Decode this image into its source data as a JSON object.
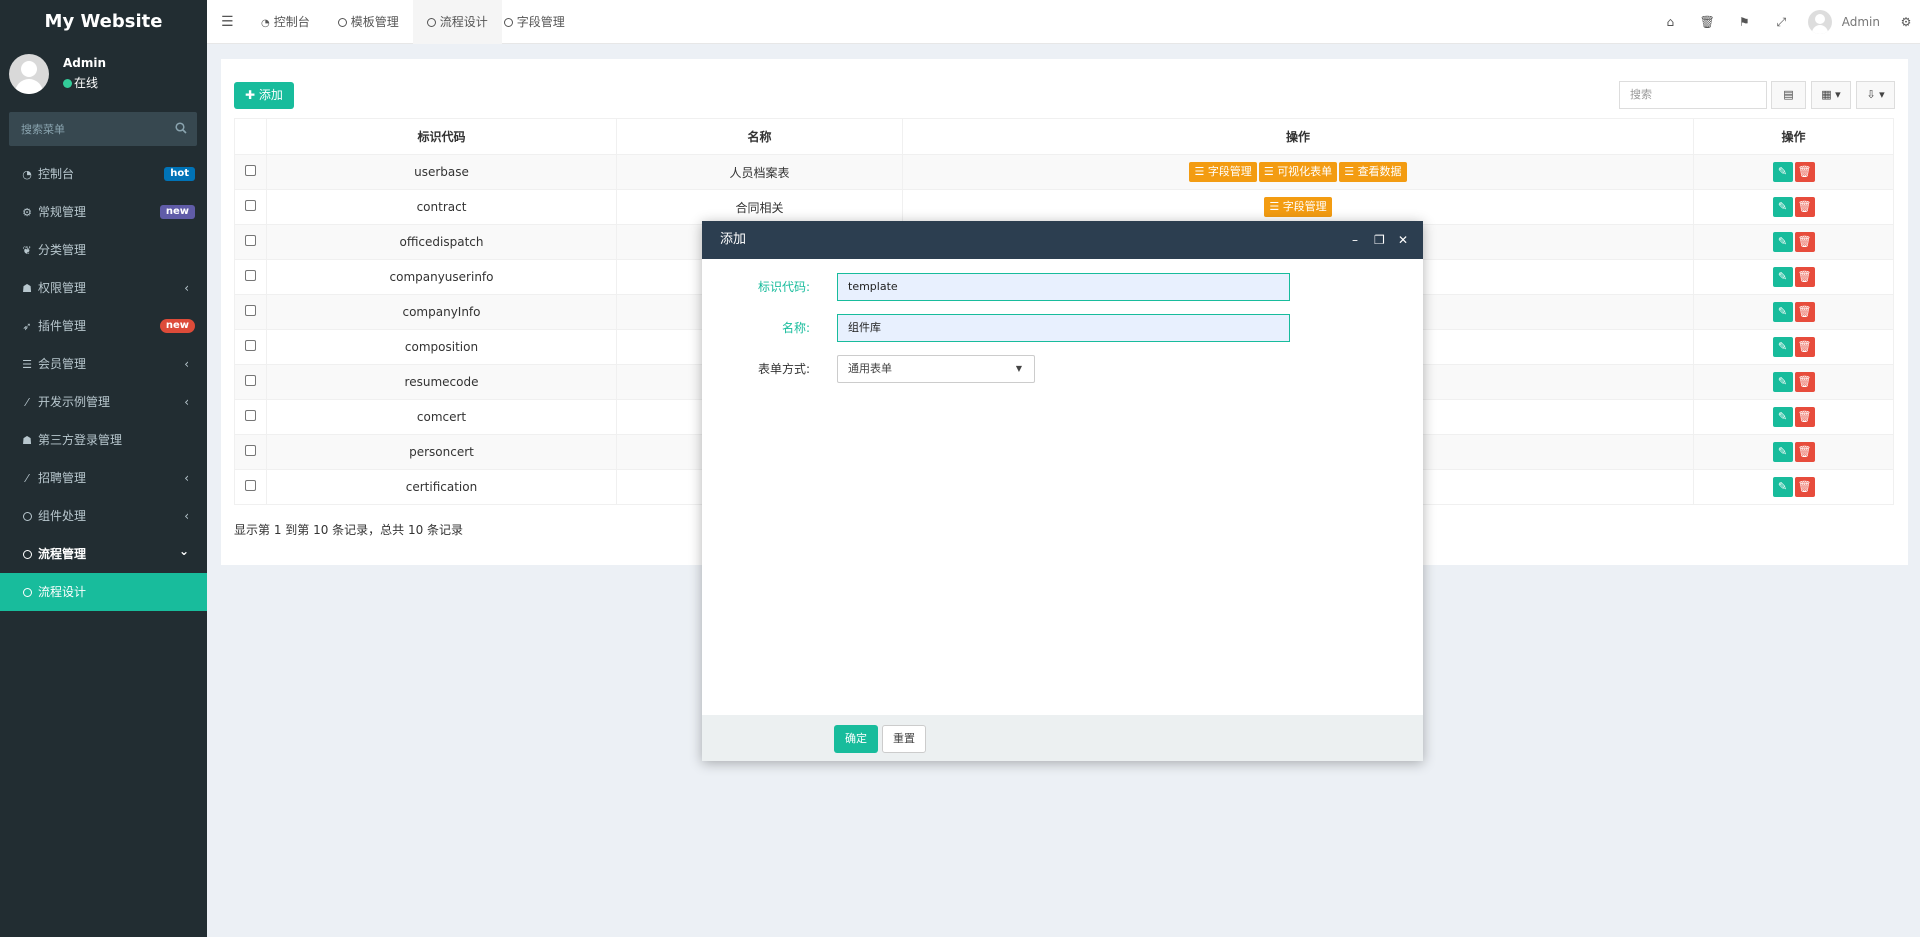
{
  "app": {
    "title": "My Website"
  },
  "user": {
    "name": "Admin",
    "status": "在线"
  },
  "sidebar": {
    "search_placeholder": "搜索菜单",
    "items": [
      {
        "icon": "dashboard-icon",
        "label": "控制台",
        "badge": "hot",
        "badge_color": "#0073b7"
      },
      {
        "icon": "cogs-icon",
        "label": "常规管理",
        "badge": "new",
        "badge_color": "#605ca8"
      },
      {
        "icon": "leaf-icon",
        "label": "分类管理"
      },
      {
        "icon": "group-icon",
        "label": "权限管理",
        "chevron": "‹"
      },
      {
        "icon": "rocket-icon",
        "label": "插件管理",
        "badge": "new",
        "badge_color": "#dd4b39"
      },
      {
        "icon": "list-icon",
        "label": "会员管理",
        "chevron": "‹"
      },
      {
        "icon": "magic-icon",
        "label": "开发示例管理",
        "chevron": "‹"
      },
      {
        "icon": "users-icon",
        "label": "第三方登录管理"
      },
      {
        "icon": "magic-icon",
        "label": "招聘管理",
        "chevron": "‹"
      },
      {
        "icon": "circle-icon",
        "label": "组件处理",
        "chevron": "‹"
      },
      {
        "icon": "circle-icon",
        "label": "流程管理",
        "chevron": "⌄"
      },
      {
        "icon": "circle-icon",
        "label": "流程设计"
      }
    ]
  },
  "navbar": {
    "tabs": [
      {
        "icon": "dashboard-icon",
        "label": "控制台"
      },
      {
        "icon": "circle-icon",
        "label": "模板管理"
      },
      {
        "icon": "circle-icon",
        "label": "流程设计"
      },
      {
        "icon": "circle-icon",
        "label": "字段管理"
      }
    ],
    "user": "Admin"
  },
  "toolbar": {
    "add_label": "添加",
    "search_placeholder": "搜索"
  },
  "table": {
    "headers": [
      "标识代码",
      "名称",
      "操作",
      "操作"
    ],
    "rows": [
      {
        "code": "userbase",
        "name": "人员档案表",
        "tags": [
          "字段管理",
          "可视化表单",
          "查看数据"
        ]
      },
      {
        "code": "contract",
        "name": "合同相关",
        "tags": [
          "字段管理"
        ]
      },
      {
        "code": "officedispatch",
        "name": "",
        "tags": []
      },
      {
        "code": "companyuserinfo",
        "name": "",
        "tags": []
      },
      {
        "code": "companyInfo",
        "name": "",
        "tags": []
      },
      {
        "code": "composition",
        "name": "",
        "tags": []
      },
      {
        "code": "resumecode",
        "name": "",
        "tags": []
      },
      {
        "code": "comcert",
        "name": "",
        "tags": []
      },
      {
        "code": "personcert",
        "name": "",
        "tags": []
      },
      {
        "code": "certification",
        "name": "",
        "tags": []
      }
    ],
    "footer": "显示第 1 到第 10 条记录，总共 10 条记录"
  },
  "modal": {
    "title": "添加",
    "fields": {
      "code_label": "标识代码:",
      "code_value": "template",
      "name_label": "名称:",
      "name_value": "组件库",
      "form_type_label": "表单方式:",
      "form_type_value": "通用表单"
    },
    "ok_label": "确定",
    "reset_label": "重置"
  },
  "colors": {
    "primary": "#18bc9c",
    "warning": "#f39c12",
    "danger": "#e74c3c",
    "sidebar": "#222d32",
    "modal_header": "#2c3e50"
  }
}
